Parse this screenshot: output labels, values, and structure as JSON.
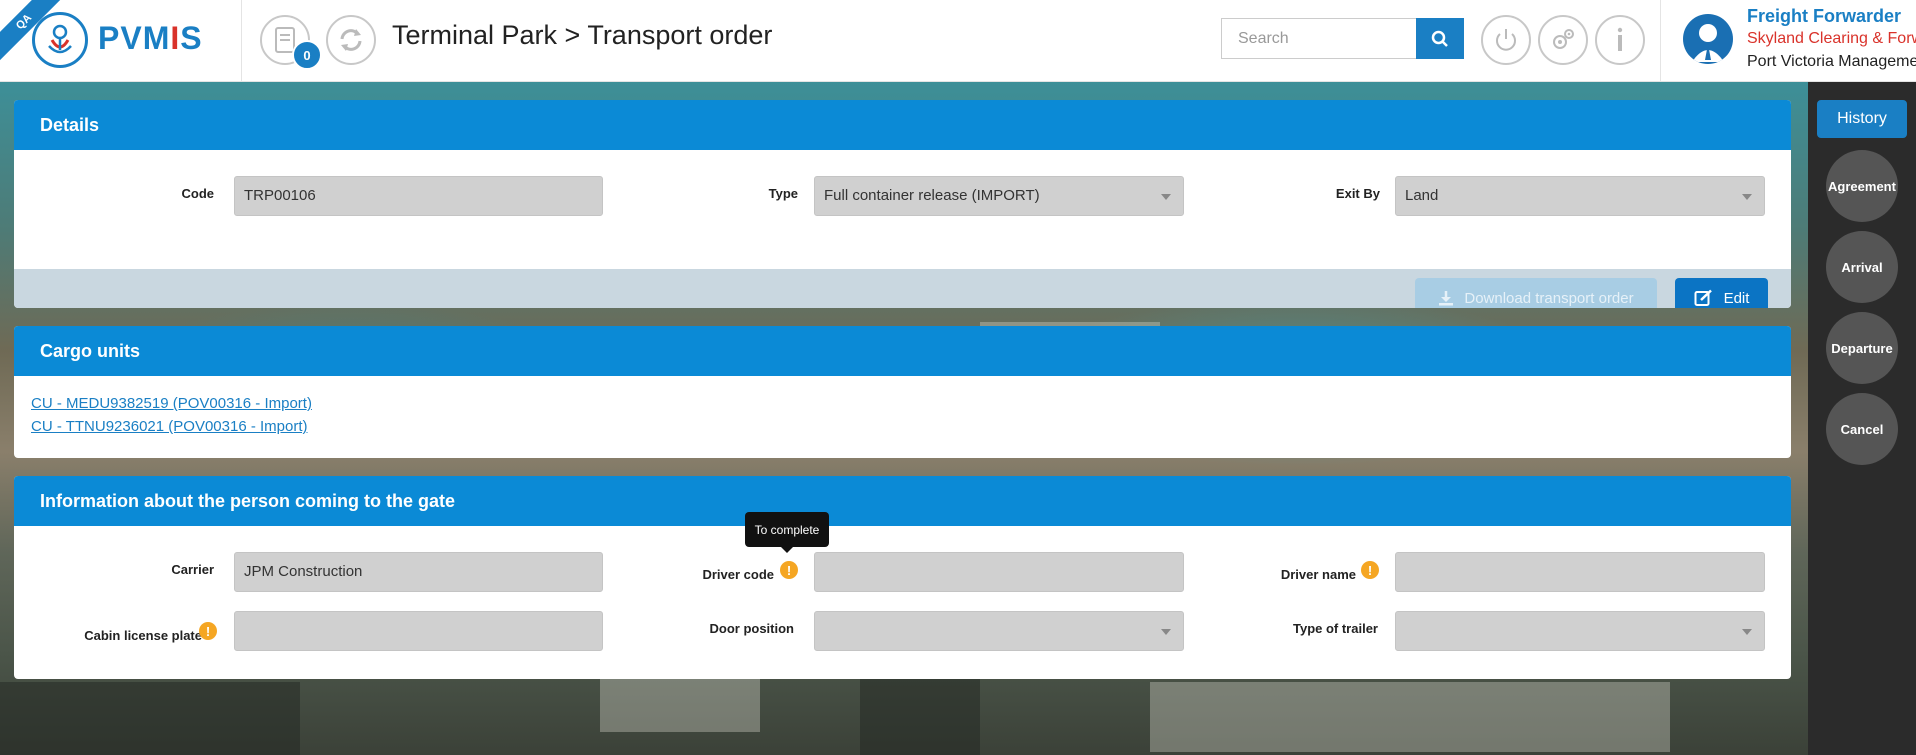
{
  "header": {
    "env_ribbon": "QA",
    "logo_text_a": "PVM",
    "logo_text_b": "I",
    "logo_text_c": "S",
    "notifications_count": "0",
    "breadcrumb": "Terminal Park > Transport order",
    "search_placeholder": "Search",
    "user": {
      "role": "Freight Forwarder",
      "company": "Skyland Clearing & Forwarding",
      "organization": "Port Victoria Management"
    }
  },
  "details": {
    "title": "Details",
    "code_label": "Code",
    "code_value": "TRP00106",
    "type_label": "Type",
    "type_value": "Full container release (IMPORT)",
    "exit_label": "Exit By",
    "exit_value": "Land",
    "download_label": "Download transport order",
    "edit_label": "Edit"
  },
  "cargo": {
    "title": "Cargo units",
    "links": [
      "CU - MEDU9382519 (POV00316 - Import)",
      "CU - TTNU9236021 (POV00316 - Import)"
    ]
  },
  "person": {
    "title": "Information about the person coming to the gate",
    "carrier_label": "Carrier",
    "carrier_value": "JPM Construction",
    "driver_code_label": "Driver code",
    "driver_code_value": "",
    "driver_name_label": "Driver name",
    "driver_name_value": "",
    "cabin_label": "Cabin license plate",
    "cabin_value": "",
    "door_label": "Door position",
    "door_value": "",
    "trailer_label": "Type of trailer",
    "trailer_value": "",
    "tooltip": "To complete",
    "warn_mark": "!"
  },
  "sidebar": {
    "history": "History",
    "agreement": "Agreement",
    "arrival": "Arrival",
    "departure": "Departure",
    "cancel": "Cancel"
  },
  "colors": {
    "brand_blue": "#1a7fc4",
    "panel_header": "#0b8ad6",
    "brand_red": "#d9322a",
    "warning": "#f5a623"
  }
}
